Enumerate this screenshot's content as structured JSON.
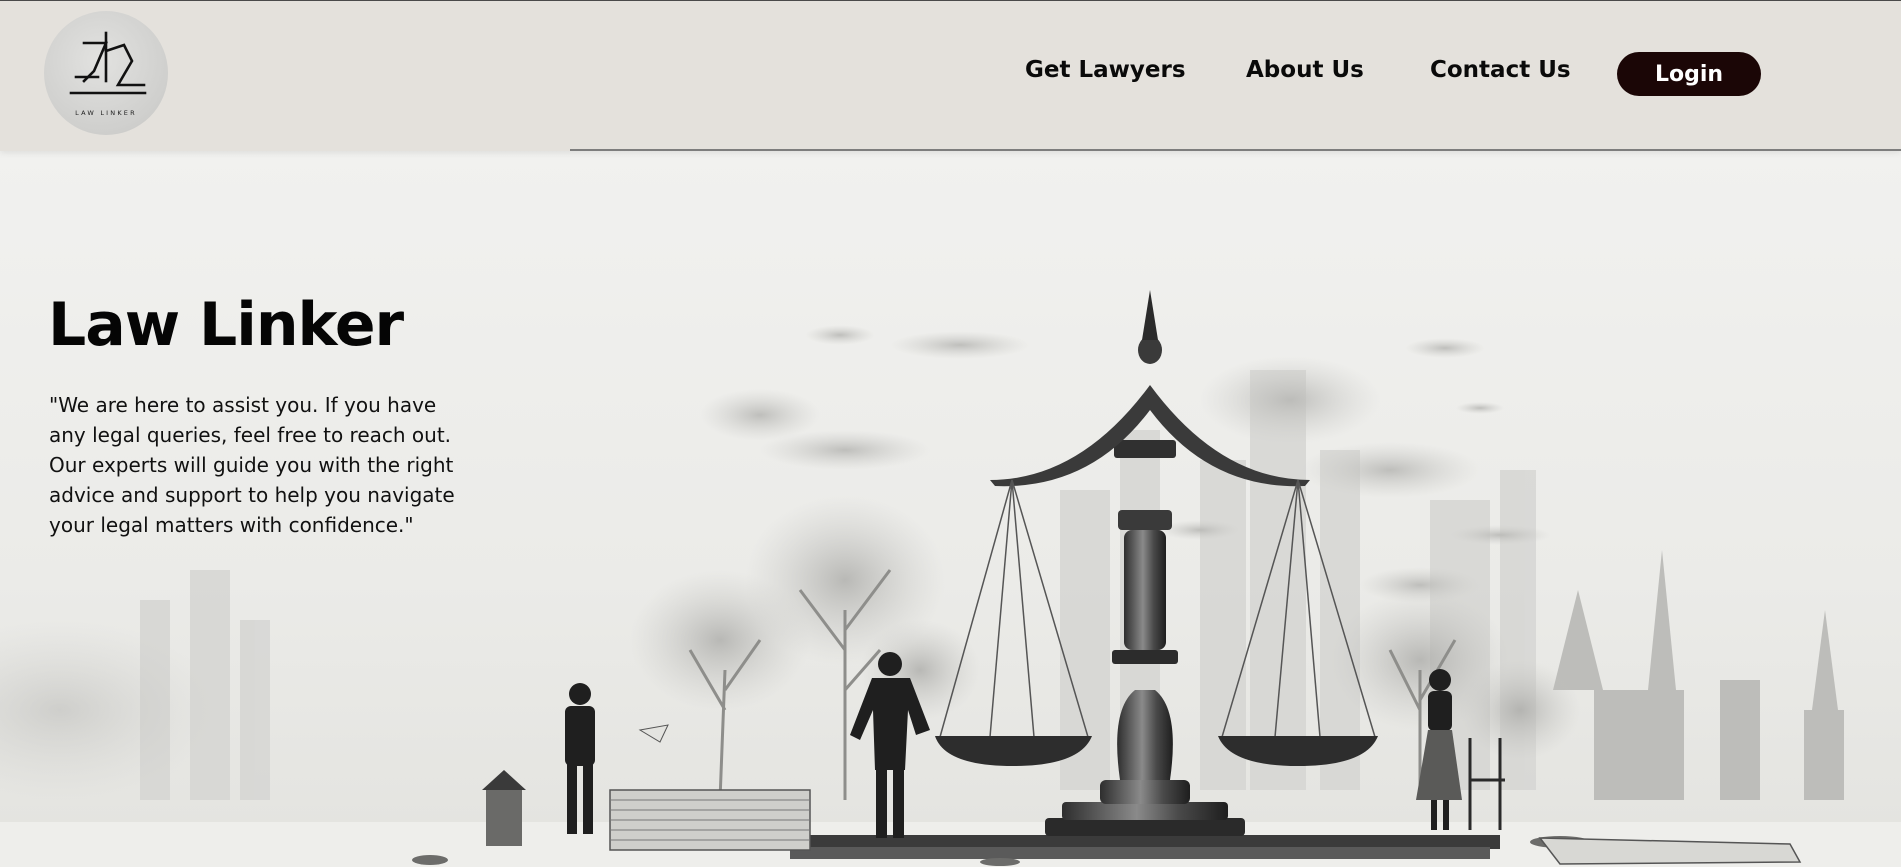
{
  "header": {
    "logo_text": "LAW LINKER",
    "nav": {
      "get_lawyers": "Get Lawyers",
      "about_us": "About Us",
      "contact_us": "Contact Us"
    },
    "login_label": "Login"
  },
  "hero": {
    "title": "Law Linker",
    "quote": "\"We are here to assist you. If you have any legal queries, feel free to reach out. Our experts will guide you with the right advice and support to help you navigate your legal matters with confidence.\"",
    "image": "scales-of-justice-illustration"
  },
  "colors": {
    "header_bg": "#e4e1dc",
    "login_bg": "#1b0606",
    "login_text": "#ffffff",
    "text": "#0a0a0a"
  }
}
